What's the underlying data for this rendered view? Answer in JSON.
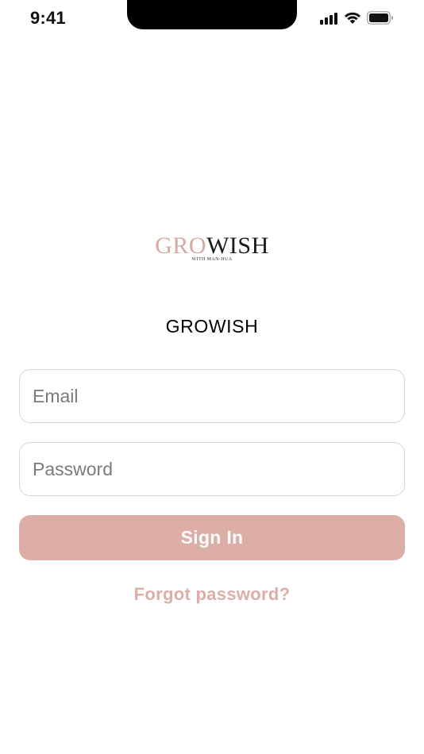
{
  "status_bar": {
    "time": "9:41",
    "icons": [
      "cellular-signal-icon",
      "wifi-icon",
      "battery-icon"
    ]
  },
  "logo": {
    "part_a": "GRO",
    "part_b": "WISH",
    "tagline": "WITH MAN-HUA",
    "colors": {
      "part_a": "#d4aaa2",
      "part_b": "#1a1a1a"
    }
  },
  "heading": "GROWISH",
  "form": {
    "email_placeholder": "Email",
    "password_placeholder": "Password",
    "sign_in_label": "Sign In",
    "forgot_label": "Forgot password?"
  },
  "colors": {
    "accent": "#dcaea5",
    "border": "#d7d7d7"
  }
}
